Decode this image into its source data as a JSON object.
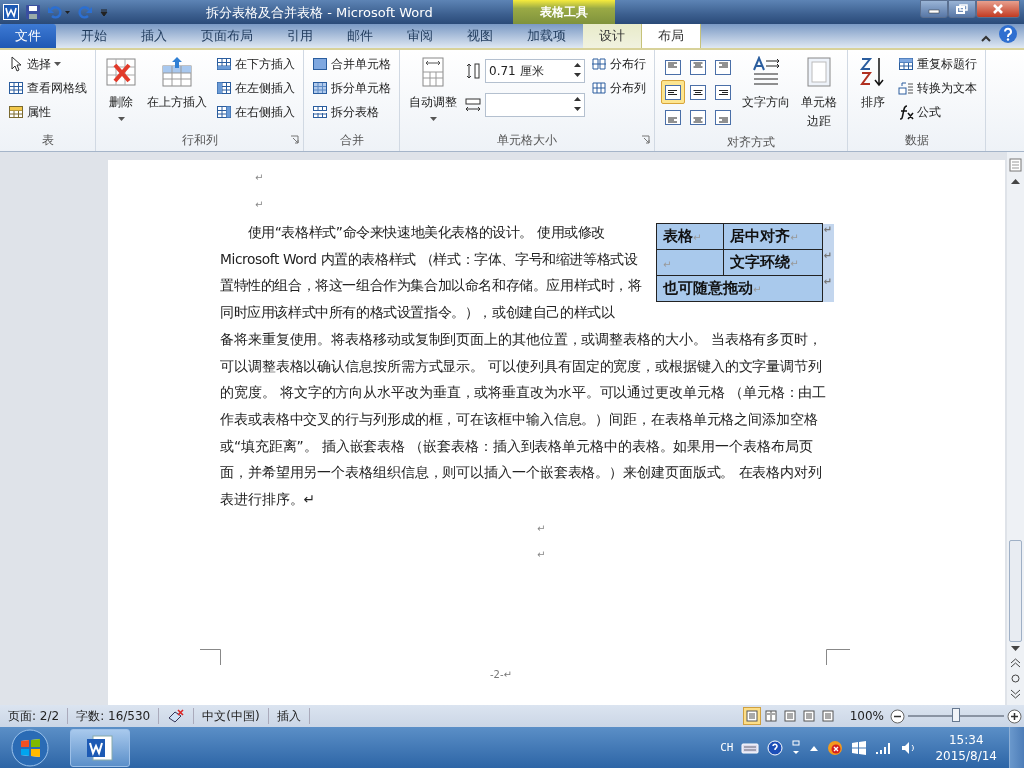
{
  "window": {
    "title": "拆分表格及合并表格 - Microsoft Word",
    "context_group": "表格工具"
  },
  "tabs": [
    {
      "label": "文件",
      "kind": "file",
      "selected": false
    },
    {
      "label": "开始",
      "kind": "normal",
      "selected": false
    },
    {
      "label": "插入",
      "kind": "normal",
      "selected": false
    },
    {
      "label": "页面布局",
      "kind": "normal",
      "selected": false
    },
    {
      "label": "引用",
      "kind": "normal",
      "selected": false
    },
    {
      "label": "邮件",
      "kind": "normal",
      "selected": false
    },
    {
      "label": "审阅",
      "kind": "normal",
      "selected": false
    },
    {
      "label": "视图",
      "kind": "normal",
      "selected": false
    },
    {
      "label": "加载项",
      "kind": "normal",
      "selected": false
    },
    {
      "label": "设计",
      "kind": "context",
      "selected": false
    },
    {
      "label": "布局",
      "kind": "context",
      "selected": true
    }
  ],
  "ribbon": {
    "groups": [
      {
        "label": "表",
        "launcher": false,
        "columns": [
          {
            "kind": "stack",
            "items": [
              {
                "label": "选择",
                "dropdown": true
              },
              {
                "label": "查看网格线",
                "dropdown": false
              },
              {
                "label": "属性",
                "dropdown": false
              }
            ]
          }
        ]
      },
      {
        "label": "行和列",
        "launcher": true,
        "columns": [
          {
            "kind": "large",
            "label": "删除",
            "dropdown": true
          },
          {
            "kind": "large",
            "label": "在上方插入",
            "dropdown": false
          },
          {
            "kind": "stack",
            "items": [
              {
                "label": "在下方插入",
                "dropdown": false
              },
              {
                "label": "在左侧插入",
                "dropdown": false
              },
              {
                "label": "在右侧插入",
                "dropdown": false
              }
            ]
          }
        ]
      },
      {
        "label": "合并",
        "launcher": false,
        "columns": [
          {
            "kind": "stack",
            "items": [
              {
                "label": "合并单元格",
                "dropdown": false
              },
              {
                "label": "拆分单元格",
                "dropdown": false
              },
              {
                "label": "拆分表格",
                "dropdown": false
              }
            ]
          }
        ]
      },
      {
        "label": "单元格大小",
        "launcher": true,
        "columns": [
          {
            "kind": "large",
            "label": "自动调整",
            "dropdown": true
          },
          {
            "kind": "spin",
            "fields": [
              {
                "kind": "height",
                "value": "0.71 厘米"
              },
              {
                "kind": "width"
              }
            ]
          },
          {
            "kind": "stack",
            "items": [
              {
                "label": "分布行",
                "dropdown": false
              },
              {
                "label": "分布列",
                "dropdown": false
              }
            ]
          }
        ]
      },
      {
        "label": "对齐方式",
        "launcher": false,
        "columns": [
          {
            "kind": "align",
            "cells": [
              {
                "selected": false
              },
              {
                "selected": false
              },
              {
                "selected": false
              },
              {
                "selected": true
              },
              {
                "selected": false
              },
              {
                "selected": false
              },
              {
                "selected": false
              },
              {
                "selected": false
              },
              {
                "selected": false
              }
            ]
          },
          {
            "kind": "large",
            "label": "文字方向",
            "dropdown": false
          },
          {
            "kind": "large",
            "label": "单元格边距",
            "dropdown": false
          }
        ]
      },
      {
        "label": "数据",
        "launcher": false,
        "columns": [
          {
            "kind": "large",
            "label": "排序",
            "dropdown": false
          },
          {
            "kind": "stack",
            "items": [
              {
                "label": "重复标题行",
                "dropdown": false
              },
              {
                "label": "转换为文本",
                "dropdown": false
              },
              {
                "label": "公式",
                "dropdown": false
              }
            ]
          }
        ]
      }
    ]
  },
  "document": {
    "top_marks": [
      "↵",
      "↵"
    ],
    "paragraph": {
      "beside_table": "使用“表格样式”命令来快速地美化表格的设计。 使用或修改 Microsoft Word 内置的表格样式 （样式：字体、字号和缩进等格式设置特性的组合，将这一组合作为集合加以命名和存储。应用样式时，将同时应用该样式中所有的格式设置指令。），或创建自己的样式以",
      "below_table": "备将来重复使用。将表格移动或复制到页面上的其他位置，或调整表格的大小。 当表格有多页时，可以调整表格以确认信息按所需方式显示。 可以使列具有固定的宽度，或根据键入的文字量调节列的宽度。 将文字的方向从水平改为垂直，或将垂直改为水平。可以通过更改单元格 （单元格：由工作表或表格中交叉的行与列形成的框，可在该框中输入信息。）间距，在表格单元格之间添加空格或“填充距离”。 插入嵌套表格 （嵌套表格：插入到表格单元格中的表格。如果用一个表格布局页面，并希望用另一个表格组织信息，则可以插入一个嵌套表格。）来创建页面版式。 在表格内对列表进行排序。↵"
    },
    "table": {
      "selected": true,
      "rows": [
        {
          "cells": [
            {
              "text": "表格",
              "mark": "↵"
            },
            {
              "text": "居中对齐",
              "mark": "↵"
            }
          ],
          "end_mark": "↵"
        },
        {
          "cells": [
            {
              "mark": "↵"
            },
            {
              "text": "文字环绕",
              "mark": "↵"
            }
          ],
          "end_mark": "↵"
        },
        {
          "cells": [
            {
              "text": "也可随意拖动",
              "mark": "↵",
              "colspan": 2
            }
          ],
          "end_mark": "↵"
        }
      ]
    },
    "bottom_marks": [
      "↵",
      "↵"
    ],
    "page_number": "-2-↵"
  },
  "status_bar": {
    "page": "页面: 2/2",
    "words": "字数: 16/530",
    "language": "中文(中国)",
    "mode": "插入",
    "views": [
      {
        "selected": true
      },
      {
        "selected": false
      },
      {
        "selected": false
      },
      {
        "selected": false
      },
      {
        "selected": false
      }
    ],
    "zoom": "100%",
    "zoom_slider": {
      "level": 0.5
    }
  },
  "taskbar": {
    "language": "CH",
    "time": "15:34",
    "date": "2015/8/14"
  }
}
